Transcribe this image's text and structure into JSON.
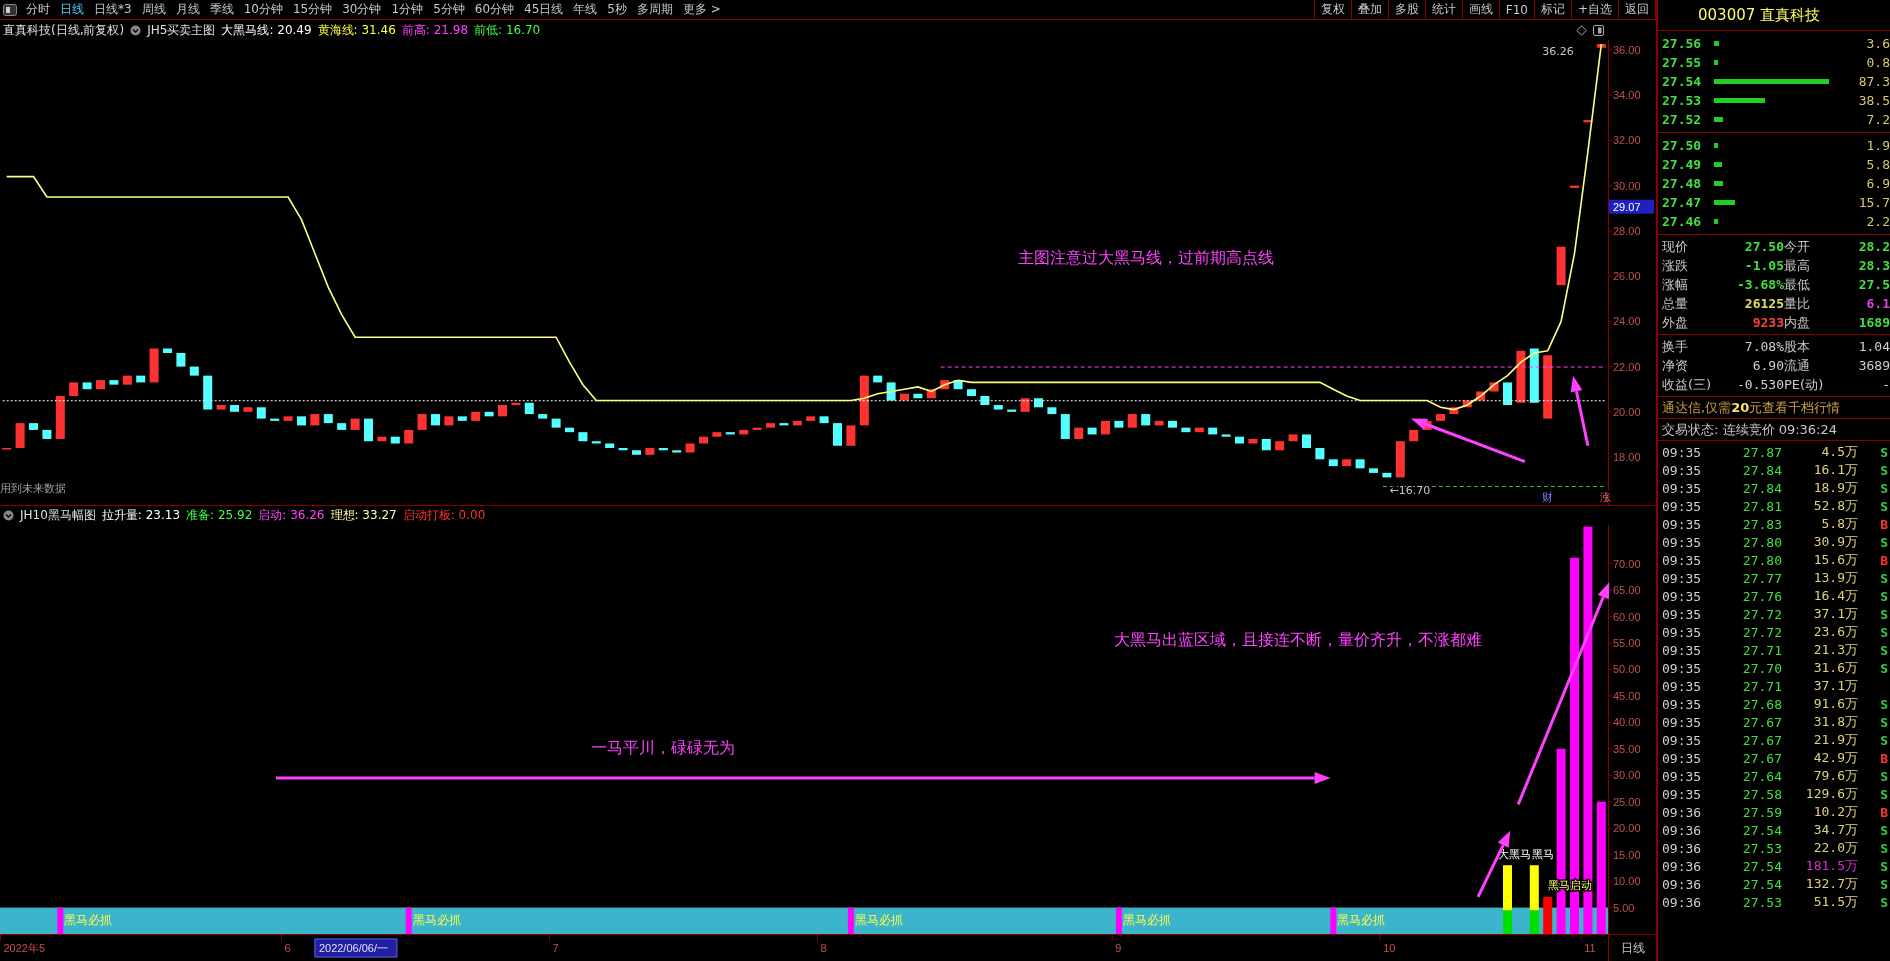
{
  "toolbar": {
    "periods": [
      {
        "label": "分时",
        "selected": false
      },
      {
        "label": "日线",
        "selected": true
      },
      {
        "label": "日线*3",
        "selected": false
      },
      {
        "label": "周线",
        "selected": false
      },
      {
        "label": "月线",
        "selected": false
      },
      {
        "label": "季线",
        "selected": false
      },
      {
        "label": "10分钟",
        "selected": false
      },
      {
        "label": "15分钟",
        "selected": false
      },
      {
        "label": "30分钟",
        "selected": false
      },
      {
        "label": "1分钟",
        "selected": false
      },
      {
        "label": "5分钟",
        "selected": false
      },
      {
        "label": "60分钟",
        "selected": false
      },
      {
        "label": "45日线",
        "selected": false
      },
      {
        "label": "年线",
        "selected": false
      },
      {
        "label": "5秒",
        "selected": false
      },
      {
        "label": "多周期",
        "selected": false
      },
      {
        "label": "更多 >",
        "selected": false
      }
    ],
    "buttons": [
      "复权",
      "叠加",
      "多股",
      "统计",
      "画线",
      "F10",
      "标记",
      "+自选",
      "返回"
    ]
  },
  "main_chart": {
    "legend": {
      "title": "直真科技(日线,前复权)",
      "indicator": "JH5买卖主图",
      "items": [
        {
          "text": "大黑马线: 20.49",
          "color": "#ffffff"
        },
        {
          "text": "黄海线: 31.46",
          "color": "#ffff40"
        },
        {
          "text": "前高: 21.98",
          "color": "#ff40ff"
        },
        {
          "text": "前低: 16.70",
          "color": "#40ff40"
        }
      ]
    },
    "chart_data": {
      "type": "line",
      "ylim": [
        15.88,
        36.44
      ],
      "categories": [
        null,
        null,
        null,
        null,
        null,
        null,
        null,
        null,
        null,
        null,
        null,
        null,
        null,
        null,
        null,
        null,
        null,
        null,
        null,
        null,
        null,
        null,
        null,
        null,
        null,
        null,
        null,
        null,
        null,
        null,
        null,
        null,
        null,
        null,
        null,
        null,
        null,
        null,
        null,
        null,
        null,
        null,
        null,
        null,
        null,
        null,
        null,
        null,
        null,
        null,
        null,
        null,
        null,
        null,
        null,
        null,
        null,
        null,
        null,
        null,
        null,
        null,
        null,
        null,
        null,
        null,
        null,
        null,
        null,
        null,
        null,
        null,
        null,
        null,
        null,
        null,
        null,
        null,
        null,
        null,
        null,
        null,
        null,
        null,
        null,
        null,
        null,
        null,
        null,
        null,
        null,
        null,
        null,
        null,
        null,
        null,
        null,
        null,
        null,
        null,
        null,
        null,
        null,
        null,
        null,
        null,
        null,
        null,
        null,
        null,
        null,
        null,
        null,
        null,
        null,
        null,
        null,
        null,
        null,
        null
      ],
      "yticks": [
        {
          "value": 18,
          "label": "18.00"
        },
        {
          "value": 20,
          "label": "20.00"
        },
        {
          "value": 22,
          "label": "22.00"
        },
        {
          "value": 24,
          "label": "24.00"
        },
        {
          "value": 26,
          "label": "26.00"
        },
        {
          "value": 28,
          "label": "28.00"
        },
        {
          "value": 30,
          "label": "30.00"
        },
        {
          "value": 32,
          "label": "32.00"
        },
        {
          "value": 34,
          "label": "34.00"
        },
        {
          "value": 36,
          "label": "36.00"
        }
      ],
      "series": [
        {
          "color": "#ffff80",
          "values": [
            30.4,
            30.4,
            30.4,
            29.5,
            29.5,
            29.5,
            29.5,
            29.5,
            29.5,
            29.5,
            29.5,
            29.5,
            29.5,
            29.5,
            29.5,
            29.5,
            29.5,
            29.5,
            29.5,
            29.5,
            29.5,
            29.5,
            28.5,
            27.0,
            25.5,
            24.3,
            23.3,
            23.3,
            23.3,
            23.3,
            23.3,
            23.3,
            23.3,
            23.3,
            23.3,
            23.3,
            23.3,
            23.3,
            23.3,
            23.3,
            23.3,
            23.3,
            22.2,
            21.2,
            20.5,
            20.5,
            20.5,
            20.5,
            20.5,
            20.5,
            20.5,
            20.5,
            20.5,
            20.5,
            20.5,
            20.5,
            20.5,
            20.5,
            20.5,
            20.5,
            20.5,
            20.5,
            20.5,
            20.5,
            20.6,
            20.8,
            20.9,
            21.0,
            21.1,
            20.9,
            21.2,
            21.4,
            21.3,
            21.3,
            21.3,
            21.3,
            21.3,
            21.3,
            21.3,
            21.3,
            21.3,
            21.3,
            21.3,
            21.3,
            21.3,
            21.3,
            21.3,
            21.3,
            21.3,
            21.3,
            21.3,
            21.3,
            21.3,
            21.3,
            21.3,
            21.3,
            21.3,
            21.3,
            21.3,
            21.0,
            20.7,
            20.5,
            20.5,
            20.5,
            20.5,
            20.5,
            20.5,
            20.2,
            20.1,
            20.3,
            20.7,
            21.2,
            21.6,
            22.2,
            22.6,
            22.7,
            24.0,
            27.0,
            31.5,
            36.26
          ]
        }
      ],
      "annotations": [
        "主图注意过大黑马线，过前期高点线",
        "用到未来数据",
        "←16.70",
        "36.26",
        "财",
        "涨",
        "29.07"
      ]
    }
  },
  "sub_chart": {
    "legend": {
      "indicator": "JH10黑马幅图",
      "items": [
        {
          "text": "拉升量: 23.13",
          "color": "#ffffff"
        },
        {
          "text": "准备: 25.92",
          "color": "#40ff40"
        },
        {
          "text": "启动: 36.26",
          "color": "#ff40ff"
        },
        {
          "text": "理想: 33.27",
          "color": "#ffffa0"
        },
        {
          "text": "启动打板: 0.00",
          "color": "#ff3030"
        }
      ]
    },
    "chart_data": {
      "type": "bar",
      "stacked": true,
      "ylim": [
        0,
        77.3
      ],
      "categories": [
        "2022年5",
        null,
        null,
        null,
        null,
        null,
        null,
        null,
        null,
        null,
        null,
        null,
        null,
        null,
        null,
        null,
        null,
        null,
        null,
        null,
        null,
        "6",
        null,
        null,
        null,
        null,
        null,
        null,
        null,
        null,
        null,
        null,
        null,
        null,
        null,
        null,
        null,
        null,
        null,
        null,
        null,
        "7",
        null,
        null,
        null,
        null,
        null,
        null,
        null,
        null,
        null,
        null,
        null,
        null,
        null,
        null,
        null,
        null,
        null,
        null,
        null,
        "8",
        null,
        null,
        null,
        null,
        null,
        null,
        null,
        null,
        null,
        null,
        null,
        null,
        null,
        null,
        null,
        null,
        null,
        null,
        null,
        null,
        null,
        "9",
        null,
        null,
        null,
        null,
        null,
        null,
        null,
        null,
        null,
        null,
        null,
        null,
        null,
        null,
        null,
        null,
        null,
        null,
        null,
        "10",
        null,
        null,
        null,
        null,
        null,
        null,
        null,
        null,
        null,
        null,
        null,
        null,
        null,
        null,
        "11",
        null
      ],
      "yticks": [
        {
          "value": 5,
          "label": "5.00"
        },
        {
          "value": 10,
          "label": "10.00"
        },
        {
          "value": 15,
          "label": "15.00"
        },
        {
          "value": 20,
          "label": "20.00"
        },
        {
          "value": 25,
          "label": "25.00"
        },
        {
          "value": 30,
          "label": "30.00"
        },
        {
          "value": 35,
          "label": "35.00"
        },
        {
          "value": 40,
          "label": "40.00"
        },
        {
          "value": 45,
          "label": "45.00"
        },
        {
          "value": 50,
          "label": "50.00"
        },
        {
          "value": 55,
          "label": "55.00"
        },
        {
          "value": 60,
          "label": "60.00"
        },
        {
          "value": 65,
          "label": "65.00"
        },
        {
          "value": 70,
          "label": "70.00"
        }
      ],
      "series": [
        {
          "color": "#00e000",
          "values": [
            null,
            null,
            null,
            null,
            null,
            null,
            null,
            null,
            null,
            null,
            null,
            null,
            null,
            null,
            null,
            null,
            null,
            null,
            null,
            null,
            null,
            null,
            null,
            null,
            null,
            null,
            null,
            null,
            null,
            null,
            null,
            null,
            null,
            null,
            null,
            null,
            null,
            null,
            null,
            null,
            null,
            null,
            null,
            null,
            null,
            null,
            null,
            null,
            null,
            null,
            null,
            null,
            null,
            null,
            null,
            null,
            null,
            null,
            null,
            null,
            null,
            null,
            null,
            null,
            null,
            null,
            null,
            null,
            null,
            null,
            null,
            null,
            null,
            null,
            null,
            null,
            null,
            null,
            null,
            null,
            null,
            null,
            null,
            null,
            null,
            null,
            null,
            null,
            null,
            null,
            null,
            null,
            null,
            null,
            null,
            null,
            null,
            null,
            null,
            null,
            null,
            null,
            null,
            null,
            null,
            null,
            null,
            null,
            null,
            null,
            null,
            null,
            4.5,
            null,
            4.5,
            null,
            null,
            null,
            null,
            null
          ]
        },
        {
          "color": "#ffff00",
          "values": [
            null,
            null,
            null,
            null,
            null,
            null,
            null,
            null,
            null,
            null,
            null,
            null,
            null,
            null,
            null,
            null,
            null,
            null,
            null,
            null,
            null,
            null,
            null,
            null,
            null,
            null,
            null,
            null,
            null,
            null,
            null,
            null,
            null,
            null,
            null,
            null,
            null,
            null,
            null,
            null,
            null,
            null,
            null,
            null,
            null,
            null,
            null,
            null,
            null,
            null,
            null,
            null,
            null,
            null,
            null,
            null,
            null,
            null,
            null,
            null,
            null,
            null,
            null,
            null,
            null,
            null,
            null,
            null,
            null,
            null,
            null,
            null,
            null,
            null,
            null,
            null,
            null,
            null,
            null,
            null,
            null,
            null,
            null,
            null,
            null,
            null,
            null,
            null,
            null,
            null,
            null,
            null,
            null,
            null,
            null,
            null,
            null,
            null,
            null,
            null,
            null,
            null,
            null,
            null,
            null,
            null,
            null,
            null,
            null,
            null,
            null,
            null,
            8.5,
            null,
            8.5,
            null,
            null,
            null,
            null,
            null
          ]
        },
        {
          "color": "#ff0000",
          "values": [
            null,
            null,
            null,
            null,
            null,
            null,
            null,
            null,
            null,
            null,
            null,
            null,
            null,
            null,
            null,
            null,
            null,
            null,
            null,
            null,
            null,
            null,
            null,
            null,
            null,
            null,
            null,
            null,
            null,
            null,
            null,
            null,
            null,
            null,
            null,
            null,
            null,
            null,
            null,
            null,
            null,
            null,
            null,
            null,
            null,
            null,
            null,
            null,
            null,
            null,
            null,
            null,
            null,
            null,
            null,
            null,
            null,
            null,
            null,
            null,
            null,
            null,
            null,
            null,
            null,
            null,
            null,
            null,
            null,
            null,
            null,
            null,
            null,
            null,
            null,
            null,
            null,
            null,
            null,
            null,
            null,
            null,
            null,
            null,
            null,
            null,
            null,
            null,
            null,
            null,
            null,
            null,
            null,
            null,
            null,
            null,
            null,
            null,
            null,
            null,
            null,
            null,
            null,
            null,
            null,
            null,
            null,
            null,
            null,
            null,
            null,
            null,
            null,
            null,
            null,
            7.0,
            null,
            null,
            null,
            null
          ]
        },
        {
          "color": "#ff00ff",
          "values": [
            null,
            null,
            null,
            null,
            null,
            null,
            null,
            null,
            null,
            null,
            null,
            null,
            null,
            null,
            null,
            null,
            null,
            null,
            null,
            null,
            null,
            null,
            null,
            null,
            null,
            null,
            null,
            null,
            null,
            null,
            null,
            null,
            null,
            null,
            null,
            null,
            null,
            null,
            null,
            null,
            null,
            null,
            null,
            null,
            null,
            null,
            null,
            null,
            null,
            null,
            null,
            null,
            null,
            null,
            null,
            null,
            null,
            null,
            null,
            null,
            null,
            null,
            null,
            null,
            null,
            null,
            null,
            null,
            null,
            null,
            null,
            null,
            null,
            null,
            null,
            null,
            null,
            null,
            null,
            null,
            null,
            null,
            null,
            null,
            null,
            null,
            null,
            null,
            null,
            null,
            null,
            null,
            null,
            null,
            null,
            null,
            null,
            null,
            null,
            null,
            null,
            null,
            null,
            null,
            null,
            null,
            null,
            null,
            null,
            null,
            null,
            null,
            null,
            null,
            null,
            null,
            35.0,
            71.1,
            77.0,
            25.0
          ]
        }
      ],
      "annotations": [
        "黑马必抓",
        "黑马必抓",
        "黑马必抓",
        "黑马必抓",
        "黑马必抓",
        "大黑马",
        "黑马",
        "黑马启动",
        "大黑马出蓝区域，且接连不断，量价齐升，不涨都难",
        "一马平川，碌碌无为"
      ]
    },
    "cursor_label": "2022/06/06/一",
    "period_button": "日线"
  },
  "quote_panel": {
    "title": "003007 直真科技",
    "asks": [
      {
        "price": "27.56",
        "volume": "3.6"
      },
      {
        "price": "27.55",
        "volume": "0.8"
      },
      {
        "price": "27.54",
        "volume": "87.3"
      },
      {
        "price": "27.53",
        "volume": "38.5"
      },
      {
        "price": "27.52",
        "volume": "7.2"
      }
    ],
    "bids": [
      {
        "price": "27.50",
        "volume": "1.9"
      },
      {
        "price": "27.49",
        "volume": "5.8"
      },
      {
        "price": "27.48",
        "volume": "6.9"
      },
      {
        "price": "27.47",
        "volume": "15.7"
      },
      {
        "price": "27.46",
        "volume": "2.2"
      }
    ],
    "stats": [
      {
        "label": "现价",
        "value": "27.50",
        "color": "#40e040"
      },
      {
        "label": "今开",
        "value": "28.2",
        "color": "#40e040"
      },
      {
        "label": "涨跌",
        "value": "-1.05",
        "color": "#40e040"
      },
      {
        "label": "最高",
        "value": "28.3",
        "color": "#40e040"
      },
      {
        "label": "涨幅",
        "value": "-3.68%",
        "color": "#40e040"
      },
      {
        "label": "最低",
        "value": "27.5",
        "color": "#40e040"
      },
      {
        "label": "总量",
        "value": "26125",
        "color": "#e0e060"
      },
      {
        "label": "量比",
        "value": "6.1",
        "color": "#e040e0"
      },
      {
        "label": "外盘",
        "value": "9233",
        "color": "#ff4040"
      },
      {
        "label": "内盘",
        "value": "1689",
        "color": "#40e040"
      }
    ],
    "fundamentals": [
      {
        "label": "换手",
        "value": "7.08%"
      },
      {
        "label": "股本",
        "value": "1.04"
      },
      {
        "label": "净资",
        "value": "6.90"
      },
      {
        "label": "流通",
        "value": "3689"
      },
      {
        "label": "收益(三)",
        "value": "-0.530"
      },
      {
        "label": "PE(动)",
        "value": "-"
      }
    ],
    "notice": "通达信,仅需**20**元查看千档行情",
    "status": "交易状态: 连续竞价 09:36:24",
    "ticks": [
      {
        "time": "09:35",
        "price": "27.87",
        "volume": "4.5万",
        "side": "S",
        "kind": "sell",
        "large": false
      },
      {
        "time": "09:35",
        "price": "27.84",
        "volume": "16.1万",
        "side": "S",
        "kind": "sell",
        "large": false
      },
      {
        "time": "09:35",
        "price": "27.84",
        "volume": "18.9万",
        "side": "S",
        "kind": "sell",
        "large": false
      },
      {
        "time": "09:35",
        "price": "27.81",
        "volume": "52.8万",
        "side": "S",
        "kind": "sell",
        "large": false
      },
      {
        "time": "09:35",
        "price": "27.83",
        "volume": "5.8万",
        "side": "B",
        "kind": "buy",
        "large": false
      },
      {
        "time": "09:35",
        "price": "27.80",
        "volume": "30.9万",
        "side": "S",
        "kind": "sell",
        "large": false
      },
      {
        "time": "09:35",
        "price": "27.80",
        "volume": "15.6万",
        "side": "B",
        "kind": "buy",
        "large": false
      },
      {
        "time": "09:35",
        "price": "27.77",
        "volume": "13.9万",
        "side": "S",
        "kind": "sell",
        "large": false
      },
      {
        "time": "09:35",
        "price": "27.76",
        "volume": "16.4万",
        "side": "S",
        "kind": "sell",
        "large": false
      },
      {
        "time": "09:35",
        "price": "27.72",
        "volume": "37.1万",
        "side": "S",
        "kind": "sell",
        "large": false
      },
      {
        "time": "09:35",
        "price": "27.72",
        "volume": "23.6万",
        "side": "S",
        "kind": "sell",
        "large": false
      },
      {
        "time": "09:35",
        "price": "27.71",
        "volume": "21.3万",
        "side": "S",
        "kind": "sell",
        "large": false
      },
      {
        "time": "09:35",
        "price": "27.70",
        "volume": "31.6万",
        "side": "S",
        "kind": "sell",
        "large": false
      },
      {
        "time": "09:35",
        "price": "27.71",
        "volume": "37.1万",
        "large": false
      },
      {
        "time": "09:35",
        "price": "27.68",
        "volume": "91.6万",
        "side": "S",
        "kind": "sell",
        "large": false
      },
      {
        "time": "09:35",
        "price": "27.67",
        "volume": "31.8万",
        "side": "S",
        "kind": "sell",
        "large": false
      },
      {
        "time": "09:35",
        "price": "27.67",
        "volume": "21.9万",
        "side": "S",
        "kind": "sell",
        "large": false
      },
      {
        "time": "09:35",
        "price": "27.67",
        "volume": "42.9万",
        "side": "B",
        "kind": "buy",
        "large": false
      },
      {
        "time": "09:35",
        "price": "27.64",
        "volume": "79.6万",
        "side": "S",
        "kind": "sell",
        "large": false
      },
      {
        "time": "09:35",
        "price": "27.58",
        "volume": "129.6万",
        "side": "S",
        "kind": "sell",
        "large": false
      },
      {
        "time": "09:36",
        "price": "27.59",
        "volume": "10.2万",
        "side": "B",
        "kind": "buy",
        "large": false
      },
      {
        "time": "09:36",
        "price": "27.54",
        "volume": "34.7万",
        "side": "S",
        "kind": "sell",
        "large": false
      },
      {
        "time": "09:36",
        "price": "27.53",
        "volume": "22.0万",
        "side": "S",
        "kind": "sell",
        "large": false
      },
      {
        "time": "09:36",
        "price": "27.54",
        "volume": "181.5万",
        "side": "S",
        "kind": "sell",
        "large": true
      },
      {
        "time": "09:36",
        "price": "27.54",
        "volume": "132.7万",
        "side": "S",
        "kind": "sell",
        "large": false
      },
      {
        "time": "09:36",
        "price": "27.53",
        "volume": "51.5万",
        "side": "S",
        "kind": "sell",
        "large": false
      }
    ]
  }
}
